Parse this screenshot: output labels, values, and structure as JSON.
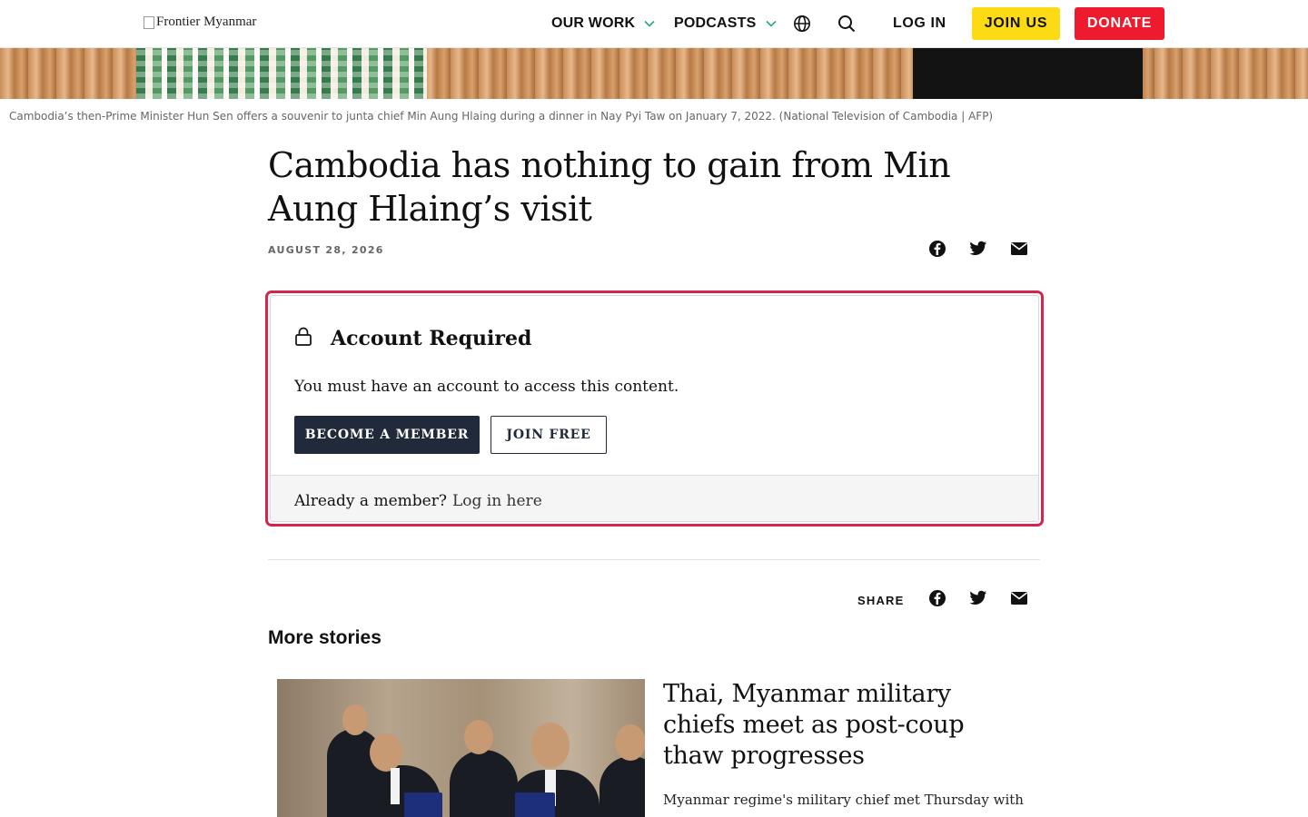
{
  "header": {
    "logo_alt": "Frontier Myanmar",
    "nav": [
      {
        "label": "OUR WORK",
        "has_dropdown": true
      },
      {
        "label": "PODCASTS",
        "has_dropdown": true
      }
    ],
    "icons": [
      "globe-icon",
      "search-icon"
    ],
    "login_label": "LOG IN",
    "join_label": "JOIN US",
    "donate_label": "DONATE",
    "colors": {
      "join": "#fddb14",
      "donate": "#ee1b2e",
      "chevron": "#2aa876"
    }
  },
  "hero": {
    "caption": "Cambodia’s then-Prime Minister Hun Sen offers a souvenir to junta chief Min Aung Hlaing during a dinner in Nay Pyi Taw on January 7, 2022. (National Television of Cambodia | AFP)"
  },
  "article": {
    "title": "Cambodia has nothing to gain from Min Aung Hlaing’s visit",
    "date": "AUGUST 28, 2026",
    "share_icons": [
      "facebook-icon",
      "twitter-icon",
      "email-icon"
    ]
  },
  "paywall": {
    "title": "Account Required",
    "message": "You must have an account to access this content.",
    "member_button": "BECOME A MEMBER",
    "free_button": "JOIN FREE",
    "footer_text": "Already a member?",
    "footer_link": "Log in here",
    "border_color": "#d22651"
  },
  "share_section": {
    "label": "SHARE",
    "icons": [
      "facebook-icon",
      "twitter-icon",
      "email-icon"
    ]
  },
  "more_stories": {
    "heading": "More stories",
    "stories": [
      {
        "title": "Thai, Myanmar military chiefs meet as post-coup thaw progresses",
        "summary": "Myanmar regime's military chief met Thursday with"
      }
    ]
  }
}
